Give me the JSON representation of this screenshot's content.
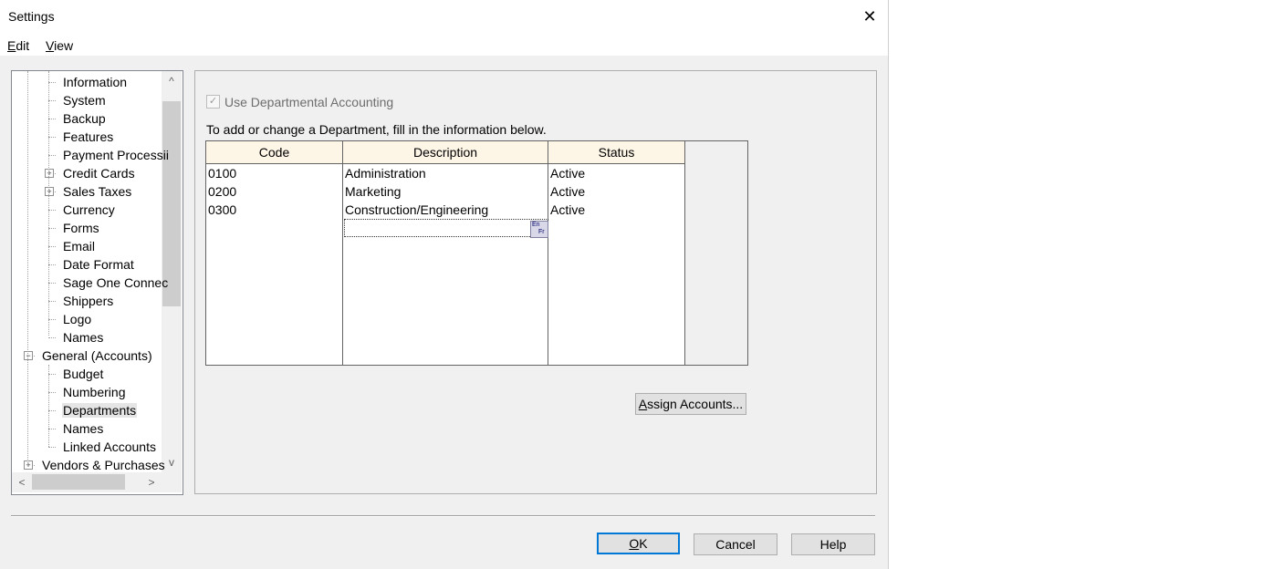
{
  "window": {
    "title": "Settings",
    "close_glyph": "✕"
  },
  "menu": [
    {
      "label": "Edit",
      "mnemonic": "E",
      "rest": "dit"
    },
    {
      "label": "View",
      "mnemonic": "V",
      "rest": "iew"
    }
  ],
  "tree": {
    "items": [
      {
        "label": "Information",
        "level": 2,
        "expander": ""
      },
      {
        "label": "System",
        "level": 2,
        "expander": ""
      },
      {
        "label": "Backup",
        "level": 2,
        "expander": ""
      },
      {
        "label": "Features",
        "level": 2,
        "expander": ""
      },
      {
        "label": "Payment Processii",
        "level": 2,
        "expander": ""
      },
      {
        "label": "Credit Cards",
        "level": 2,
        "expander": "+"
      },
      {
        "label": "Sales Taxes",
        "level": 2,
        "expander": "+"
      },
      {
        "label": "Currency",
        "level": 2,
        "expander": ""
      },
      {
        "label": "Forms",
        "level": 2,
        "expander": ""
      },
      {
        "label": "Email",
        "level": 2,
        "expander": ""
      },
      {
        "label": "Date Format",
        "level": 2,
        "expander": ""
      },
      {
        "label": "Sage One Connec",
        "level": 2,
        "expander": ""
      },
      {
        "label": "Shippers",
        "level": 2,
        "expander": ""
      },
      {
        "label": "Logo",
        "level": 2,
        "expander": ""
      },
      {
        "label": "Names",
        "level": 2,
        "expander": ""
      },
      {
        "label": "General (Accounts)",
        "level": 1,
        "expander": "−"
      },
      {
        "label": "Budget",
        "level": 2,
        "expander": ""
      },
      {
        "label": "Numbering",
        "level": 2,
        "expander": ""
      },
      {
        "label": "Departments",
        "level": 2,
        "expander": "",
        "selected": true
      },
      {
        "label": "Names",
        "level": 2,
        "expander": ""
      },
      {
        "label": "Linked Accounts",
        "level": 2,
        "expander": ""
      },
      {
        "label": "Vendors & Purchases",
        "level": 1,
        "expander": "+"
      }
    ],
    "scroll_up": "^",
    "scroll_down": "v",
    "scroll_left": "<",
    "scroll_right": ">"
  },
  "departmental": {
    "checkbox_label": "Use Departmental Accounting",
    "checked": true,
    "check_glyph": "✓",
    "instructions": "To add or change a Department, fill in the information below.",
    "columns": [
      "Code",
      "Description",
      "Status"
    ],
    "rows": [
      {
        "code": "0100",
        "description": "Administration",
        "status": "Active"
      },
      {
        "code": "0200",
        "description": "Marketing",
        "status": "Active"
      },
      {
        "code": "0300",
        "description": "Construction/Engineering",
        "status": "Active"
      }
    ],
    "lang_icon_top": "En",
    "lang_icon_bottom": "Fr",
    "assign_button": {
      "label": "Assign Accounts...",
      "mnemonic": "A",
      "rest": "ssign Accounts..."
    }
  },
  "buttons": {
    "ok": {
      "label": "OK",
      "mnemonic": "O",
      "rest": "K"
    },
    "cancel": "Cancel",
    "help": "Help"
  }
}
